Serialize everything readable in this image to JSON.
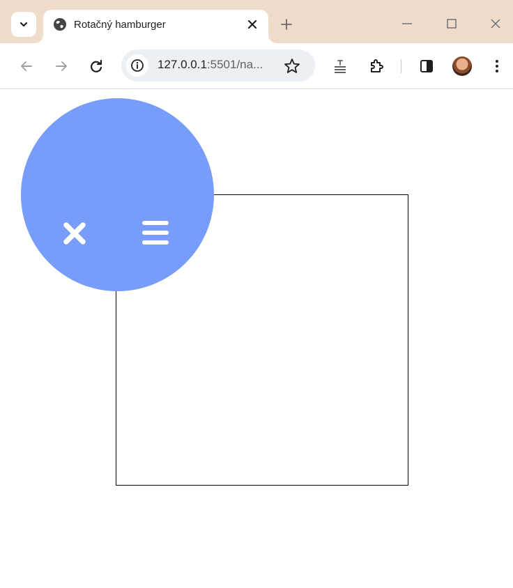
{
  "browser": {
    "tab": {
      "title": "Rotačný hamburger",
      "favicon": "globe-icon",
      "close_icon": "close-icon"
    },
    "new_tab_icon": "plus-icon",
    "window_controls": [
      "minimize-icon",
      "maximize-icon",
      "close-icon"
    ],
    "toolbar": {
      "back_icon": "arrow-left-icon",
      "forward_icon": "arrow-right-icon",
      "reload_icon": "reload-icon",
      "address": {
        "host": "127.0.0.1",
        "rest": ":5501/na..."
      },
      "bookmark_icon": "star-icon",
      "extensions": [
        "extension-a-icon",
        "puzzle-icon"
      ],
      "side_panel_icon": "side-panel-icon",
      "menu_icon": "kebab-menu-icon"
    },
    "colors": {
      "tabstrip": "#efdccb",
      "accent_circle": "#789cfa"
    }
  },
  "page": {
    "menu_circle": {
      "close_icon": "close-x-icon",
      "menu_icon": "hamburger-icon",
      "color": "#789cfa"
    }
  }
}
